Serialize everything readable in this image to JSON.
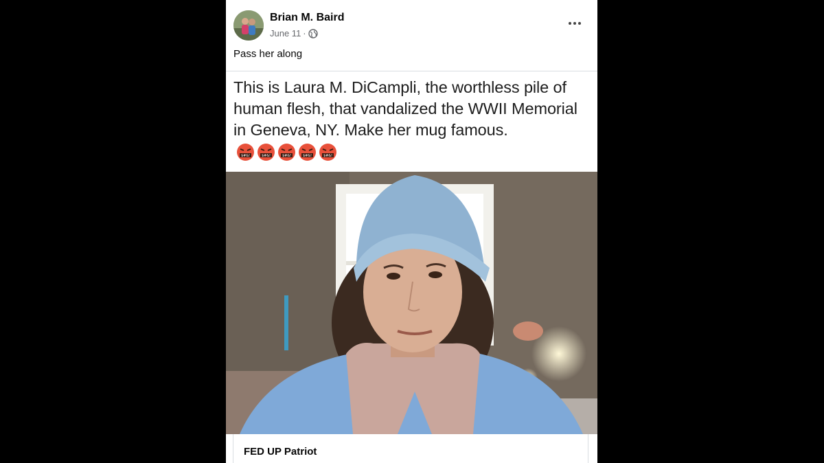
{
  "post": {
    "author": "Brian M. Baird",
    "date": "June 11",
    "separator": "·",
    "privacy_icon": "globe-icon",
    "more_icon": "more-options-icon",
    "caption": "Pass her along"
  },
  "meme": {
    "text": "This is Laura M. DiCampli, the worthless pile of human flesh, that vandalized the WWII Memorial in Geneva, NY. Make her mug famous.",
    "emoji_icon": "angry-cursing-face-icon",
    "emoji_count": 5
  },
  "link": {
    "title": "FED UP Patriot"
  },
  "colors": {
    "background": "#000000",
    "card": "#ffffff",
    "primary_text": "#050505",
    "secondary_text": "#65676b",
    "hat": "#8fb2d1",
    "emoji": "#e8503a"
  }
}
